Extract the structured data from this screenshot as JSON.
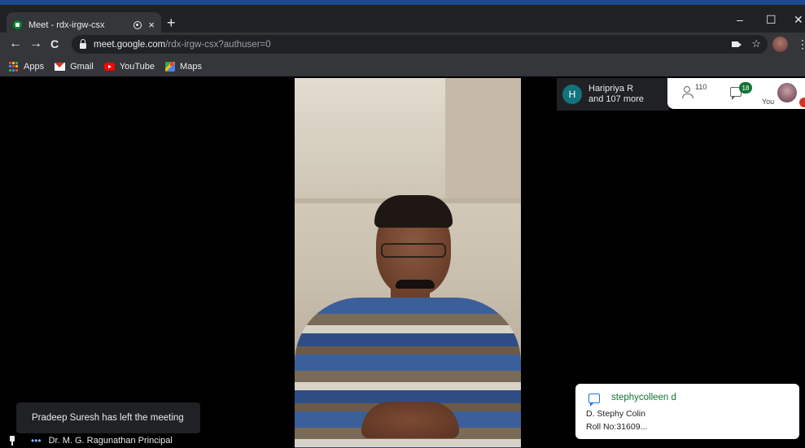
{
  "browser": {
    "tab_title": "Meet - rdx-irgw-csx",
    "tab_close": "×",
    "new_tab": "+",
    "window_controls": [
      "–",
      "☐",
      "✕"
    ],
    "nav": {
      "back": "←",
      "forward": "→",
      "reload": "C"
    },
    "url_host": "meet.google.com",
    "url_path": "/rdx-irgw-csx?authuser=0",
    "star": "☆",
    "menu": "⋮"
  },
  "bookmarks": [
    {
      "label": "Apps",
      "icon": "apps-grid-icon"
    },
    {
      "label": "Gmail",
      "icon": "gmail-icon"
    },
    {
      "label": "YouTube",
      "icon": "youtube-icon"
    },
    {
      "label": "Maps",
      "icon": "maps-icon"
    }
  ],
  "meet": {
    "people_card": {
      "initial": "H",
      "line1": "Haripriya R",
      "line2": "and 107 more"
    },
    "participants_count": "110",
    "chat_badge": "18",
    "you_label": "You",
    "toast": "Pradeep Suresh has left the meeting",
    "presenter_name": "Dr. M. G. Ragunathan Principal",
    "chat_notification": {
      "sender": "stephycolleen d",
      "line1": "D. Stephy Colin",
      "line2": "Roll No:31609..."
    }
  },
  "colors": {
    "chrome_dark": "#202124",
    "chrome_toolbar": "#35363a",
    "meet_green": "#137333",
    "avatar_teal": "#12737c",
    "alert_red": "#d93025"
  }
}
